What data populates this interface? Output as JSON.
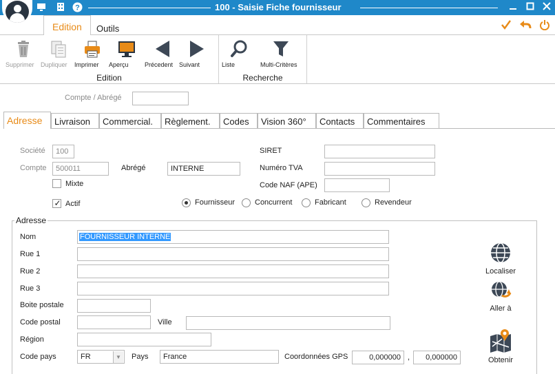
{
  "window": {
    "title": "100 - Saisie Fiche fournisseur"
  },
  "ribbon": {
    "tabs": [
      {
        "label": "Edition"
      },
      {
        "label": "Outils"
      }
    ],
    "groups": {
      "edition": {
        "label": "Edition",
        "buttons": [
          {
            "label": "Supprimer",
            "icon": "trash-icon",
            "enabled": false
          },
          {
            "label": "Dupliquer",
            "icon": "duplicate-icon",
            "enabled": false
          },
          {
            "label": "Imprimer",
            "icon": "printer-icon",
            "enabled": true
          },
          {
            "label": "Aperçu",
            "icon": "preview-monitor-icon",
            "enabled": true
          },
          {
            "label": "Précedent",
            "icon": "arrow-left-icon",
            "enabled": true
          },
          {
            "label": "Suivant",
            "icon": "arrow-right-icon",
            "enabled": true
          }
        ]
      },
      "recherche": {
        "label": "Recherche",
        "buttons": [
          {
            "label": "Liste",
            "icon": "magnifier-icon",
            "enabled": true
          },
          {
            "label": "Multi-Critères",
            "icon": "filter-funnel-icon",
            "enabled": true
          }
        ]
      }
    }
  },
  "header": {
    "compte_abrege_label": "Compte / Abrégé",
    "compte_abrege_value": ""
  },
  "tabs": [
    {
      "label": "Adresse"
    },
    {
      "label": "Livraison"
    },
    {
      "label": "Commercial."
    },
    {
      "label": "Règlement."
    },
    {
      "label": "Codes"
    },
    {
      "label": "Vision 360°"
    },
    {
      "label": "Contacts"
    },
    {
      "label": "Commentaires"
    }
  ],
  "identity": {
    "societe_label": "Société",
    "societe_value": "100",
    "compte_label": "Compte",
    "compte_value": "500011",
    "abrege_label": "Abrégé",
    "abrege_value": "INTERNE",
    "mixte_label": "Mixte",
    "mixte_checked": false,
    "actif_label": "Actif",
    "actif_checked": true,
    "siret_label": "SIRET",
    "siret_value": "",
    "tva_label": "Numéro TVA",
    "tva_value": "",
    "naf_label": "Code NAF (APE)",
    "naf_value": ""
  },
  "type_radio": {
    "options": [
      {
        "label": "Fournisseur"
      },
      {
        "label": "Concurrent"
      },
      {
        "label": "Fabricant"
      },
      {
        "label": "Revendeur"
      }
    ],
    "selected": "Fournisseur"
  },
  "address": {
    "group_title": "Adresse",
    "nom_label": "Nom",
    "nom_value": "FOURNISSEUR INTERNE",
    "rue1_label": "Rue 1",
    "rue1_value": "",
    "rue2_label": "Rue 2",
    "rue2_value": "",
    "rue3_label": "Rue 3",
    "rue3_value": "",
    "bp_label": "Boite postale",
    "bp_value": "",
    "cp_label": "Code postal",
    "cp_value": "",
    "ville_label": "Ville",
    "ville_value": "",
    "region_label": "Région",
    "region_value": "",
    "code_pays_label": "Code pays",
    "code_pays_value": "FR",
    "pays_label": "Pays",
    "pays_value": "France",
    "gps_label": "Coordonnées GPS",
    "gps_lat": "0,000000",
    "gps_sep": ",",
    "gps_lon": "0,000000"
  },
  "side_actions": [
    {
      "label": "Localiser",
      "icon": "globe-icon"
    },
    {
      "label": "Aller à",
      "icon": "globe-refresh-icon"
    },
    {
      "label": "Obtenir",
      "icon": "map-pin-icon"
    }
  ],
  "colors": {
    "titlebar": "#1f88c9",
    "accent": "#e88b18",
    "selection": "#3399ff"
  }
}
